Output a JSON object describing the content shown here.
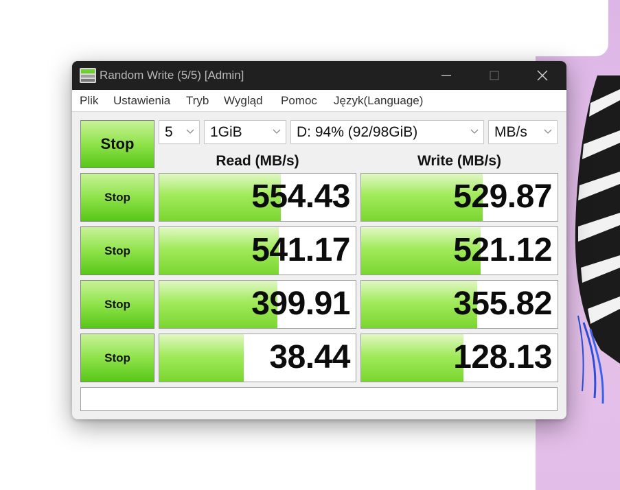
{
  "window": {
    "title": "Random Write (5/5) [Admin]"
  },
  "menu": [
    "Plik",
    "Ustawienia",
    "Tryb",
    "Wygląd",
    "Pomoc",
    "Język(Language)"
  ],
  "controls": {
    "main_button_label": "Stop",
    "count": "5",
    "size": "1GiB",
    "drive": "D: 94% (92/98GiB)",
    "unit": "MB/s"
  },
  "headers": {
    "read": "Read (MB/s)",
    "write": "Write (MB/s)"
  },
  "rows": [
    {
      "button_label": "Stop",
      "read": "554.43",
      "write": "529.87",
      "read_fill_pct": 62,
      "write_fill_pct": 62
    },
    {
      "button_label": "Stop",
      "read": "541.17",
      "write": "521.12",
      "read_fill_pct": 61,
      "write_fill_pct": 61
    },
    {
      "button_label": "Stop",
      "read": "399.91",
      "write": "355.82",
      "read_fill_pct": 60,
      "write_fill_pct": 59
    },
    {
      "button_label": "Stop",
      "read": "38.44",
      "write": "128.13",
      "read_fill_pct": 43,
      "write_fill_pct": 52
    }
  ],
  "comment": "",
  "colors": {
    "bar_green": "#7ad630",
    "titlebar": "#202020",
    "wallpaper": "#dcb6e6"
  }
}
